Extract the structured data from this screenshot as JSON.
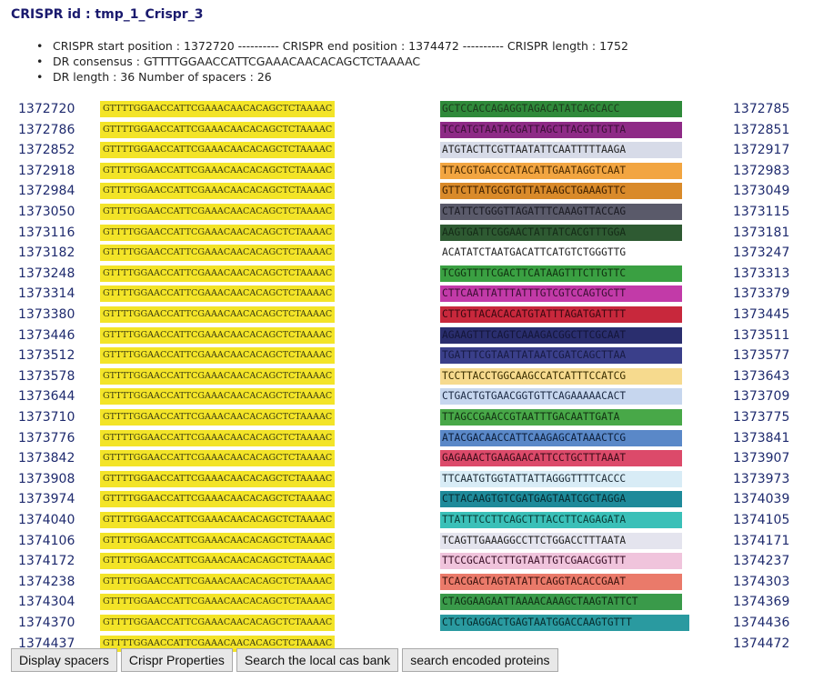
{
  "header": {
    "title": "CRISPR id : tmp_1_Crispr_3",
    "info": [
      "CRISPR start position : 1372720 ---------- CRISPR end position : 1374472 ---------- CRISPR length : 1752",
      "DR consensus : GTTTTGGAACCATTCGAAACAACACAGCTCTAAAAC",
      "DR length : 36 Number of spacers : 26"
    ]
  },
  "colors": {
    "dr_highlight": "#f3e428",
    "position_text": "#1e2a6e",
    "title_text": "#1a1a6e"
  },
  "rows": [
    {
      "start": "1372720",
      "dr": "GTTTTGGAACCATTCGAAACAACACAGCTCTAAAAC",
      "spacer": "GCTCCACCAGAGGTAGACATATCAGCACC",
      "spacer_color": "#2f8a3a",
      "spacer_text": "#1c3a1c",
      "end": "1372785"
    },
    {
      "start": "1372786",
      "dr": "GTTTTGGAACCATTCGAAACAACACAGCTCTAAAAC",
      "spacer": "TCCATGTAATACGATTAGCTTACGTTGTTA",
      "spacer_color": "#8e2a86",
      "spacer_text": "#3a1036",
      "end": "1372851"
    },
    {
      "start": "1372852",
      "dr": "GTTTTGGAACCATTCGAAACAACACAGCTCTAAAAC",
      "spacer": "ATGTACTTCGTTAATATTCAATTTTTAAGA",
      "spacer_color": "#d7dbe8",
      "spacer_text": "#222222",
      "end": "1372917"
    },
    {
      "start": "1372918",
      "dr": "GTTTTGGAACCATTCGAAACAACACAGCTCTAAAAC",
      "spacer": "TTACGTGACCCATACATTGAATAGGTCAAT",
      "spacer_color": "#f2a541",
      "spacer_text": "#4a2a00",
      "end": "1372983"
    },
    {
      "start": "1372984",
      "dr": "GTTTTGGAACCATTCGAAACAACACAGCTCTAAAAC",
      "spacer": "GTTCTTATGCGTGTTATAAGCTGAAAGTTC",
      "spacer_color": "#d98a2a",
      "spacer_text": "#3e2000",
      "end": "1373049"
    },
    {
      "start": "1373050",
      "dr": "GTTTTGGAACCATTCGAAACAACACAGCTCTAAAAC",
      "spacer": "CTATTCTGGGTTAGATTTCAAAGTTACCAG",
      "spacer_color": "#5a5a6a",
      "spacer_text": "#1a1a22",
      "end": "1373115"
    },
    {
      "start": "1373116",
      "dr": "GTTTTGGAACCATTCGAAACAACACAGCTCTAAAAC",
      "spacer": "AAGTGATTCGGAACTATTATCACGTTTGGA",
      "spacer_color": "#2e5a32",
      "spacer_text": "#142a16",
      "end": "1373181"
    },
    {
      "start": "1373182",
      "dr": "GTTTTGGAACCATTCGAAACAACACAGCTCTAAAAC",
      "spacer": "ACATATCTAATGACATTCATGTCTGGGTTG",
      "spacer_color": "#ffffff",
      "spacer_text": "#222222",
      "end": "1373247"
    },
    {
      "start": "1373248",
      "dr": "GTTTTGGAACCATTCGAAACAACACAGCTCTAAAAC",
      "spacer": "TCGGTTTTCGACTTCATAAGTTTCTTGTTC",
      "spacer_color": "#3aa042",
      "spacer_text": "#10300f",
      "end": "1373313"
    },
    {
      "start": "1373314",
      "dr": "GTTTTGGAACCATTCGAAACAACACAGCTCTAAAAC",
      "spacer": "CTTCAATTATTTATTTGTCGTCCAGTGCTT",
      "spacer_color": "#c23aa8",
      "spacer_text": "#3a0e32",
      "end": "1373379"
    },
    {
      "start": "1373380",
      "dr": "GTTTTGGAACCATTCGAAACAACACAGCTCTAAAAC",
      "spacer": "CTTGTTACACACATGTATTTAGATGATTTT",
      "spacer_color": "#c8283c",
      "spacer_text": "#3a0810",
      "end": "1373445"
    },
    {
      "start": "1373446",
      "dr": "GTTTTGGAACCATTCGAAACAACACAGCTCTAAAAC",
      "spacer": "AGAAGTTTCAGTCAAAGACGGCTTCGCAAT",
      "spacer_color": "#2a2e6e",
      "spacer_text": "#14163a",
      "end": "1373511"
    },
    {
      "start": "1373512",
      "dr": "GTTTTGGAACCATTCGAAACAACACAGCTCTAAAAC",
      "spacer": "TGATTTCGTAATTATAATCGATCAGCTTAA",
      "spacer_color": "#3a3f8a",
      "spacer_text": "#181b44",
      "end": "1373577"
    },
    {
      "start": "1373578",
      "dr": "GTTTTGGAACCATTCGAAACAACACAGCTCTAAAAC",
      "spacer": "TCCTTACCTGGCAAGCCATCATTTCCATCG",
      "spacer_color": "#f6da8e",
      "spacer_text": "#3a2e00",
      "end": "1373643"
    },
    {
      "start": "1373644",
      "dr": "GTTTTGGAACCATTCGAAACAACACAGCTCTAAAAC",
      "spacer": "CTGACTGTGAACGGTGTTCAGAAAAACACT",
      "spacer_color": "#c6d6ee",
      "spacer_text": "#1c2a44",
      "end": "1373709"
    },
    {
      "start": "1373710",
      "dr": "GTTTTGGAACCATTCGAAACAACACAGCTCTAAAAC",
      "spacer": "TTAGCCGAACCGTAATTTGACAATTGATA",
      "spacer_color": "#48a848",
      "spacer_text": "#123012",
      "end": "1373775"
    },
    {
      "start": "1373776",
      "dr": "GTTTTGGAACCATTCGAAACAACACAGCTCTAAAAC",
      "spacer": "ATACGACAACCATTCAAGAGCATAAACTCG",
      "spacer_color": "#5a88c8",
      "spacer_text": "#0c1e3a",
      "end": "1373841"
    },
    {
      "start": "1373842",
      "dr": "GTTTTGGAACCATTCGAAACAACACAGCTCTAAAAC",
      "spacer": "GAGAAACTGAAGAACATTCCTGCTTTAAAT",
      "spacer_color": "#dc4a6a",
      "spacer_text": "#3a0c18",
      "end": "1373907"
    },
    {
      "start": "1373908",
      "dr": "GTTTTGGAACCATTCGAAACAACACAGCTCTAAAAC",
      "spacer": "TTCAATGTGGTATTATTAGGGTTTTCACCC",
      "spacer_color": "#d8ecf6",
      "spacer_text": "#1c2a34",
      "end": "1373973"
    },
    {
      "start": "1373974",
      "dr": "GTTTTGGAACCATTCGAAACAACACAGCTCTAAAAC",
      "spacer": "CTTACAAGTGTCGATGAGTAATCGCTAGGA",
      "spacer_color": "#1e8a9a",
      "spacer_text": "#062a30",
      "end": "1374039"
    },
    {
      "start": "1374040",
      "dr": "GTTTTGGAACCATTCGAAACAACACAGCTCTAAAAC",
      "spacer": "TTATTTCCTTCAGCTTTACCTTCAGAGATA",
      "spacer_color": "#3ac0b8",
      "spacer_text": "#083a36",
      "end": "1374105"
    },
    {
      "start": "1374106",
      "dr": "GTTTTGGAACCATTCGAAACAACACAGCTCTAAAAC",
      "spacer": "TCAGTTGAAAGGCCTTCTGGACCTTTAATA",
      "spacer_color": "#e4e4ee",
      "spacer_text": "#222222",
      "end": "1374171"
    },
    {
      "start": "1374172",
      "dr": "GTTTTGGAACCATTCGAAACAACACAGCTCTAAAAC",
      "spacer": "TTCCGCACTCTTGTAATTGTCGAACGGTTT",
      "spacer_color": "#f0c4dc",
      "spacer_text": "#3a1028",
      "end": "1374237"
    },
    {
      "start": "1374238",
      "dr": "GTTTTGGAACCATTCGAAACAACACAGCTCTAAAAC",
      "spacer": "TCACGACTAGTATATTCAGGTACACCGAAT",
      "spacer_color": "#ea7a6a",
      "spacer_text": "#3a120c",
      "end": "1374303"
    },
    {
      "start": "1374304",
      "dr": "GTTTTGGAACCATTCGAAACAACACAGCTCTAAAAC",
      "spacer": "CTAGGAAGAATTAAAACAAAGCTAAGTATTCT",
      "spacer_color": "#3a9a4a",
      "spacer_text": "#0e2e12",
      "end": "1374369"
    },
    {
      "start": "1374370",
      "dr": "GTTTTGGAACCATTCGAAACAACACAGCTCTAAAAC",
      "spacer": "CTCTGAGGACTGAGTAATGGACCAAGTGTTT",
      "spacer_color": "#2a9aa0",
      "spacer_text": "#062a2c",
      "end": "1374436"
    },
    {
      "start": "1374437",
      "dr": "GTTTTGGAACCATTCGAAACAACACAGCTCTAAAAC",
      "spacer": "",
      "spacer_color": "",
      "spacer_text": "",
      "end": "1374472"
    }
  ],
  "buttons": [
    {
      "name": "display-spacers-button",
      "label": "Display spacers"
    },
    {
      "name": "crispr-properties-button",
      "label": "Crispr Properties"
    },
    {
      "name": "search-local-cas-bank-button",
      "label": "Search the local cas bank"
    },
    {
      "name": "search-encoded-proteins-button",
      "label": "search encoded proteins"
    }
  ]
}
